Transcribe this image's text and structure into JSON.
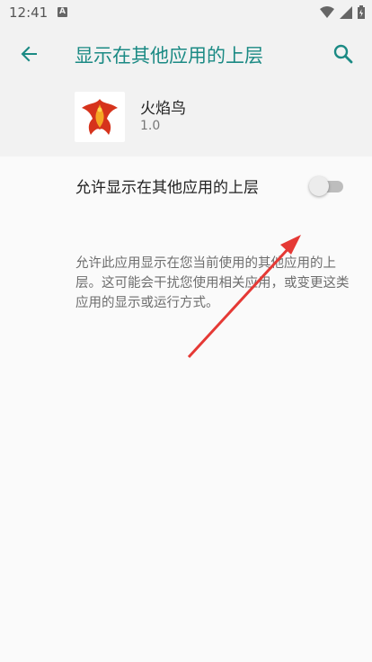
{
  "status_bar": {
    "time": "12:41",
    "notification_letter": "A"
  },
  "app_bar": {
    "title": "显示在其他应用的上层"
  },
  "app_info": {
    "name": "火焰鸟",
    "version": "1.0"
  },
  "permission": {
    "label": "允许显示在其他应用的上层",
    "enabled": false,
    "description": "允许此应用显示在您当前使用的其他应用的上层。这可能会干扰您使用相关应用，或变更这类应用的显示或运行方式。"
  },
  "colors": {
    "accent": "#1b8a84",
    "annotation_arrow": "#e53935"
  }
}
